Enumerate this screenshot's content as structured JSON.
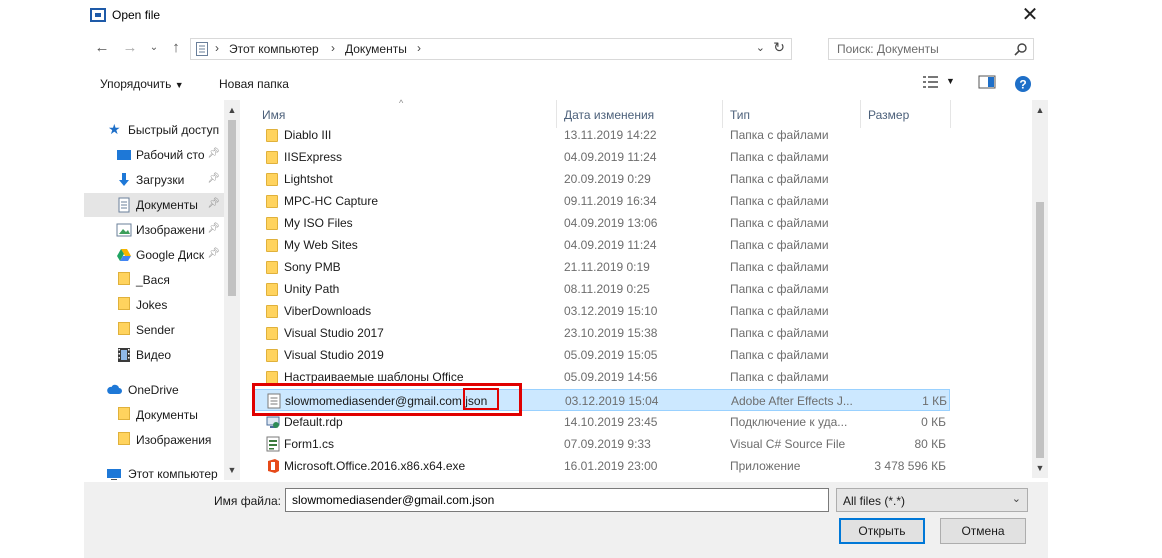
{
  "window": {
    "title": "Open file"
  },
  "nav": {
    "path": [
      "Этот компьютер",
      "Документы"
    ],
    "search_placeholder": "Поиск: Документы"
  },
  "toolbar": {
    "organize": "Упорядочить",
    "new_folder": "Новая папка"
  },
  "sidebar": {
    "items": [
      {
        "label": "Быстрый доступ",
        "icon": "star-icon"
      },
      {
        "label": "Рабочий сто",
        "icon": "desktop-icon"
      },
      {
        "label": "Загрузки",
        "icon": "download-icon"
      },
      {
        "label": "Документы",
        "icon": "document-icon"
      },
      {
        "label": "Изображени",
        "icon": "pictures-icon"
      },
      {
        "label": "Google Диск",
        "icon": "google-drive-icon"
      },
      {
        "label": "_Вася",
        "icon": "folder-icon"
      },
      {
        "label": "Jokes",
        "icon": "folder-icon"
      },
      {
        "label": "Sender",
        "icon": "folder-icon"
      },
      {
        "label": "Видео",
        "icon": "video-icon"
      },
      {
        "label": "OneDrive",
        "icon": "cloud-icon"
      },
      {
        "label": "Документы",
        "icon": "folder-icon"
      },
      {
        "label": "Изображения",
        "icon": "folder-icon"
      },
      {
        "label": "Этот компьютер",
        "icon": "computer-icon"
      }
    ]
  },
  "columns": {
    "name": "Имя",
    "date": "Дата изменения",
    "type": "Тип",
    "size": "Размер"
  },
  "files": [
    {
      "name": "Diablo III",
      "date": "13.11.2019 14:22",
      "type": "Папка с файлами",
      "size": "",
      "icon": "folder-icon"
    },
    {
      "name": "IISExpress",
      "date": "04.09.2019 11:24",
      "type": "Папка с файлами",
      "size": "",
      "icon": "folder-icon"
    },
    {
      "name": "Lightshot",
      "date": "20.09.2019 0:29",
      "type": "Папка с файлами",
      "size": "",
      "icon": "folder-icon"
    },
    {
      "name": "MPC-HC Capture",
      "date": "09.11.2019 16:34",
      "type": "Папка с файлами",
      "size": "",
      "icon": "folder-icon"
    },
    {
      "name": "My ISO Files",
      "date": "04.09.2019 13:06",
      "type": "Папка с файлами",
      "size": "",
      "icon": "folder-icon"
    },
    {
      "name": "My Web Sites",
      "date": "04.09.2019 11:24",
      "type": "Папка с файлами",
      "size": "",
      "icon": "folder-icon"
    },
    {
      "name": "Sony PMB",
      "date": "21.11.2019 0:19",
      "type": "Папка с файлами",
      "size": "",
      "icon": "folder-icon"
    },
    {
      "name": "Unity Path",
      "date": "08.11.2019 0:25",
      "type": "Папка с файлами",
      "size": "",
      "icon": "folder-icon"
    },
    {
      "name": "ViberDownloads",
      "date": "03.12.2019 15:10",
      "type": "Папка с файлами",
      "size": "",
      "icon": "folder-icon"
    },
    {
      "name": "Visual Studio 2017",
      "date": "23.10.2019 15:38",
      "type": "Папка с файлами",
      "size": "",
      "icon": "folder-icon"
    },
    {
      "name": "Visual Studio 2019",
      "date": "05.09.2019 15:05",
      "type": "Папка с файлами",
      "size": "",
      "icon": "folder-icon"
    },
    {
      "name": "Настраиваемые шаблоны Office",
      "date": "05.09.2019 14:56",
      "type": "Папка с файлами",
      "size": "",
      "icon": "folder-icon"
    },
    {
      "name": "slowmomediasender@gmail.com.json",
      "date": "03.12.2019 15:04",
      "type": "Adobe After Effects J...",
      "size": "1 КБ",
      "icon": "text-file-icon"
    },
    {
      "name": "Default.rdp",
      "date": "14.10.2019 23:45",
      "type": "Подключение к уда...",
      "size": "0 КБ",
      "icon": "remote-desktop-icon"
    },
    {
      "name": "Form1.cs",
      "date": "07.09.2019 9:33",
      "type": "Visual C# Source File",
      "size": "80 КБ",
      "icon": "csharp-file-icon"
    },
    {
      "name": "Microsoft.Office.2016.x86.x64.exe",
      "date": "16.01.2019 23:00",
      "type": "Приложение",
      "size": "3 478 596 КБ",
      "icon": "office-exe-icon"
    }
  ],
  "footer": {
    "filename_label": "Имя файла:",
    "filename_value": "slowmomediasender@gmail.com.json",
    "filetype_value": "All files (*.*)",
    "open_label": "Открыть",
    "cancel_label": "Отмена"
  },
  "colors": {
    "selection": "#cce8ff",
    "annotation_red": "#e00000",
    "accent": "#0078d7",
    "folder": "#ffd35e"
  }
}
